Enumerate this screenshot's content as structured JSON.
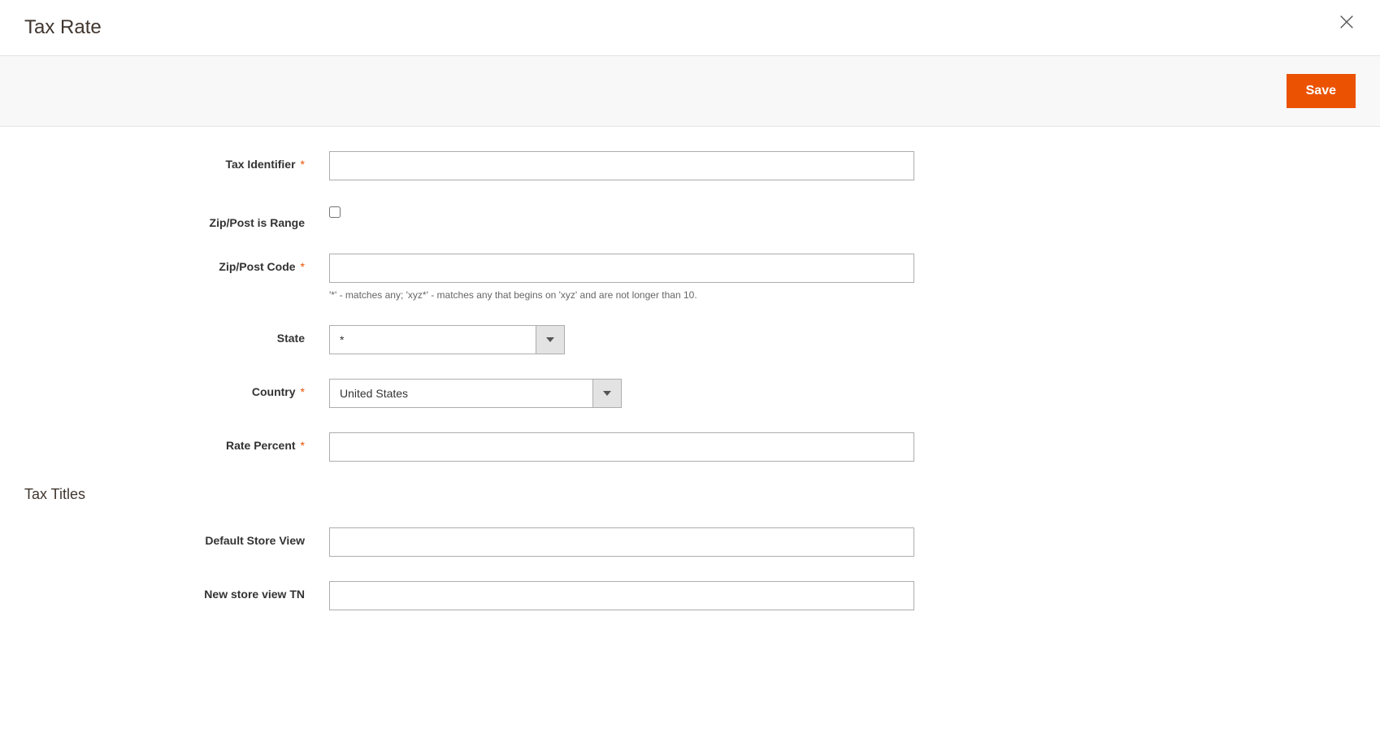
{
  "modal": {
    "title": "Tax Rate"
  },
  "toolbar": {
    "save_label": "Save"
  },
  "fields": {
    "tax_identifier": {
      "label": "Tax Identifier",
      "required": true,
      "value": ""
    },
    "zip_is_range": {
      "label": "Zip/Post is Range",
      "required": false,
      "checked": false
    },
    "zip_code": {
      "label": "Zip/Post Code",
      "required": true,
      "value": "",
      "note": "'*' - matches any; 'xyz*' - matches any that begins on 'xyz' and are not longer than 10."
    },
    "state": {
      "label": "State",
      "required": false,
      "value": "*"
    },
    "country": {
      "label": "Country",
      "required": true,
      "value": "United States"
    },
    "rate_percent": {
      "label": "Rate Percent",
      "required": true,
      "value": ""
    }
  },
  "tax_titles": {
    "heading": "Tax Titles",
    "rows": [
      {
        "label": "Default Store View",
        "value": ""
      },
      {
        "label": "New store view TN",
        "value": ""
      }
    ]
  }
}
